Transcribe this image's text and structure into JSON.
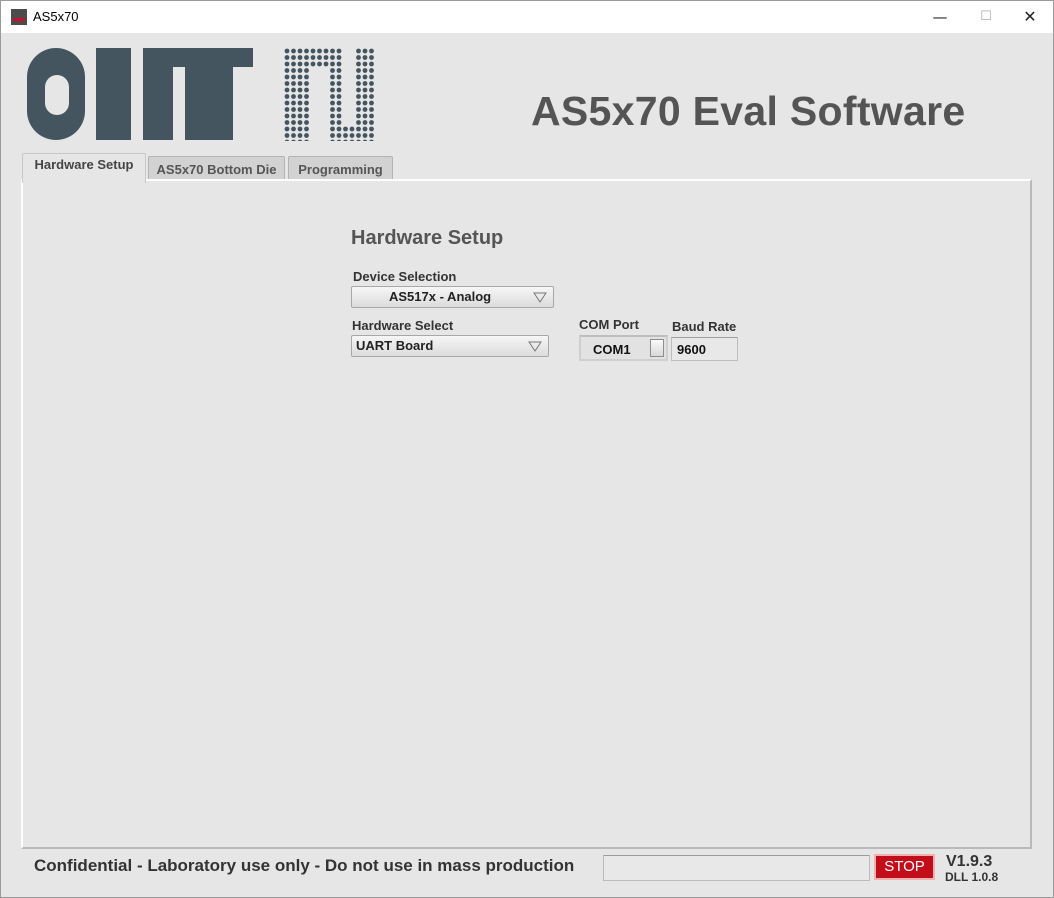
{
  "window": {
    "title": "AS5x70",
    "icon": "app-icon"
  },
  "titlebar_buttons": {
    "minimize": "—",
    "maximize": "☐",
    "close": "✕"
  },
  "logo": {
    "text": "ams",
    "color": "#455560"
  },
  "app_title": "AS5x70 Eval Software",
  "tabs": [
    {
      "label": "Hardware Setup",
      "active": true
    },
    {
      "label": "AS5x70 Bottom Die",
      "active": false
    },
    {
      "label": "Programming",
      "active": false
    }
  ],
  "hardware_setup": {
    "heading": "Hardware Setup",
    "device_selection": {
      "label": "Device Selection",
      "value": "AS517x - Analog"
    },
    "hardware_select": {
      "label": "Hardware Select",
      "value": "UART Board"
    },
    "com_port": {
      "label": "COM Port",
      "value": "COM1"
    },
    "baud_rate": {
      "label": "Baud Rate",
      "value": "9600"
    }
  },
  "footer": {
    "confidential": "Confidential - Laboratory use only - Do not use in mass production",
    "progress_percent": 0,
    "stop_label": "STOP",
    "stop_color": "#c20e1a",
    "version": "V1.9.3",
    "dll_version": "DLL 1.0.8"
  }
}
